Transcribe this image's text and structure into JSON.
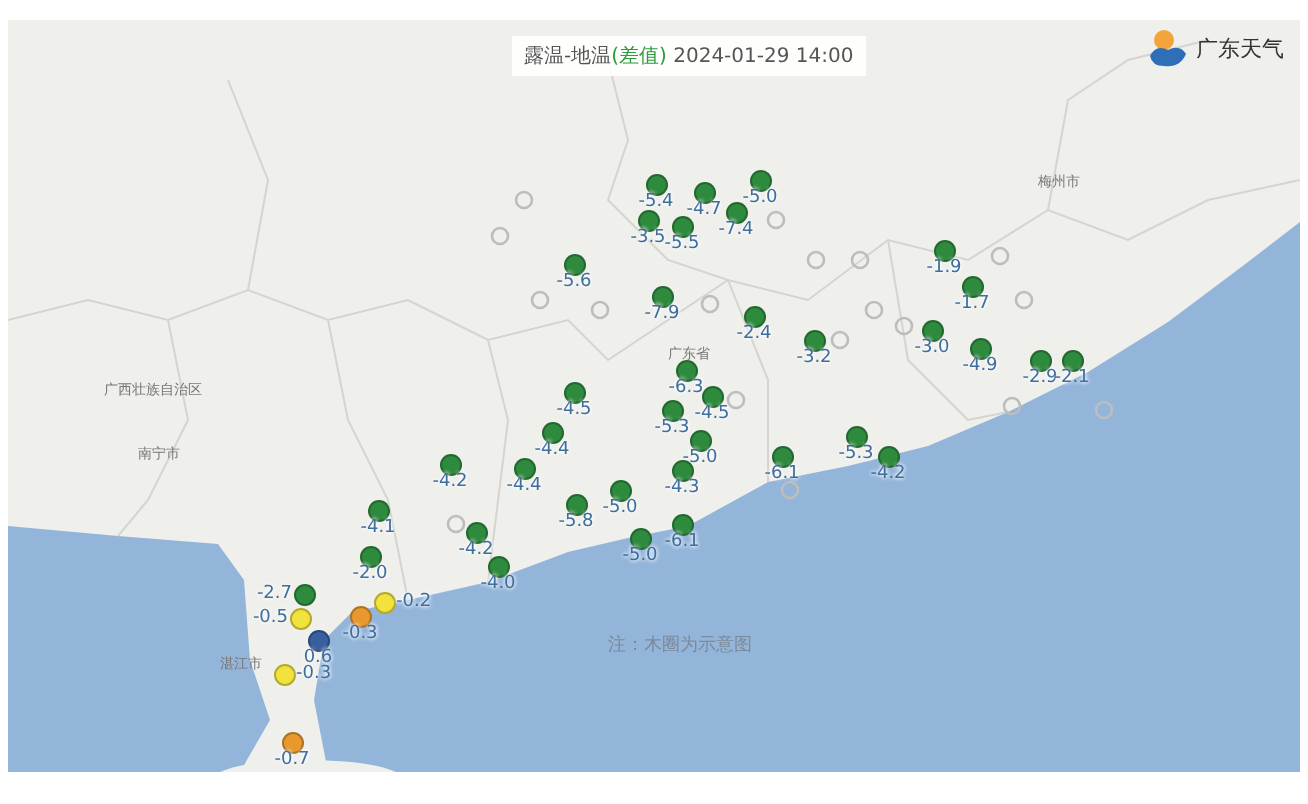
{
  "map": {
    "title": {
      "prefix": "露温-地温",
      "highlight": "(差值)",
      "timestamp": "2024-01-29 14:00"
    },
    "logo": {
      "text": "广东天气"
    },
    "place_labels": [
      {
        "text": "广西壮族自治区"
      },
      {
        "text": "广东省"
      },
      {
        "text": "湛江市"
      },
      {
        "text": "梅州市"
      },
      {
        "text": "南宁市"
      }
    ],
    "note": "注：木圈为示意图",
    "stations": [
      {
        "value": "-5.4",
        "color": "#2e8b3e"
      },
      {
        "value": "-4.7",
        "color": "#2e8b3e"
      },
      {
        "value": "-5.0",
        "color": "#2e8b3e"
      },
      {
        "value": "-7.4",
        "color": "#2e8b3e"
      },
      {
        "value": "-3.5",
        "color": "#2e8b3e"
      },
      {
        "value": "-5.5",
        "color": "#2e8b3e"
      },
      {
        "value": "-5.6",
        "color": "#2e8b3e"
      },
      {
        "value": "-7.9",
        "color": "#2e8b3e"
      },
      {
        "value": "-2.4",
        "color": "#2e8b3e"
      },
      {
        "value": "-3.2",
        "color": "#2e8b3e"
      },
      {
        "value": "-1.9",
        "color": "#2e8b3e"
      },
      {
        "value": "-1.7",
        "color": "#2e8b3e"
      },
      {
        "value": "-3.0",
        "color": "#2e8b3e"
      },
      {
        "value": "-4.9",
        "color": "#2e8b3e"
      },
      {
        "value": "-2.9",
        "color": "#2e8b3e"
      },
      {
        "value": "-2.1",
        "color": "#2e8b3e"
      },
      {
        "value": "-6.1",
        "color": "#2e8b3e"
      },
      {
        "value": "-5.3",
        "color": "#2e8b3e"
      },
      {
        "value": "-4.2",
        "color": "#2e8b3e"
      },
      {
        "value": "-6.3",
        "color": "#2e8b3e"
      },
      {
        "value": "-4.5",
        "color": "#2e8b3e"
      },
      {
        "value": "-4.5",
        "color": "#2e8b3e"
      },
      {
        "value": "-4.4",
        "color": "#2e8b3e"
      },
      {
        "value": "-5.3",
        "color": "#2e8b3e"
      },
      {
        "value": "-5.0",
        "color": "#2e8b3e"
      },
      {
        "value": "-4.2",
        "color": "#2e8b3e"
      },
      {
        "value": "-4.4",
        "color": "#2e8b3e"
      },
      {
        "value": "-5.0",
        "color": "#2e8b3e"
      },
      {
        "value": "-4.3",
        "color": "#2e8b3e"
      },
      {
        "value": "-5.8",
        "color": "#2e8b3e"
      },
      {
        "value": "-6.1",
        "color": "#2e8b3e"
      },
      {
        "value": "-5.0",
        "color": "#2e8b3e"
      },
      {
        "value": "-4.2",
        "color": "#2e8b3e"
      },
      {
        "value": "-4.1",
        "color": "#2e8b3e"
      },
      {
        "value": "-4.0",
        "color": "#2e8b3e"
      },
      {
        "value": "-2.0",
        "color": "#2e8b3e"
      },
      {
        "value": "-2.7",
        "color": "#2e8b3e"
      },
      {
        "value": "-0.2",
        "color": "#f2e23c"
      },
      {
        "value": "-0.5",
        "color": "#f2e23c"
      },
      {
        "value": "-0.3",
        "color": "#e8982c"
      },
      {
        "value": "0.6",
        "color": "#3a5fa0"
      },
      {
        "value": "-0.3",
        "color": "#f2e23c"
      },
      {
        "value": "-0.7",
        "color": "#e8982c"
      }
    ]
  }
}
